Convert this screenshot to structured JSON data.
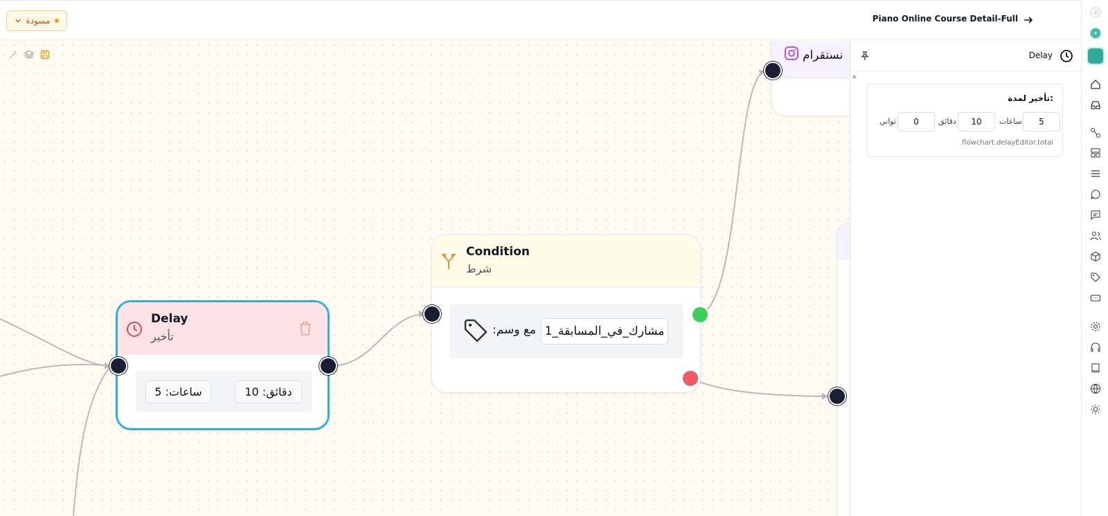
{
  "topbar": {
    "status_label": "مسودة",
    "page_title": "Piano Online Course Detail-Full"
  },
  "canvas": {
    "delay_node": {
      "title": "Delay",
      "subtitle": "تأخير",
      "minutes_chip": "دقائق: 10",
      "hours_chip": "ساعات: 5"
    },
    "condition_node": {
      "title": "Condition",
      "subtitle": "شرط",
      "with_tag_label": ":مع وسم",
      "tag_value": "مشارك_في_المسابقة_1"
    },
    "instagram_node": {
      "title_fragment": "نستقرام"
    }
  },
  "panel": {
    "title": "Delay",
    "card_title": "تأخير لمدة:",
    "hours_value": "5",
    "hours_unit": "ساعات",
    "minutes_value": "10",
    "minutes_unit": "دقائق",
    "seconds_value": "0",
    "seconds_unit": "ثواني",
    "total_note": "flowchart.delayEditor.total"
  },
  "colors": {
    "accent_teal": "#2bb3d6",
    "delay_header": "#fde3e6",
    "condition_header": "#fffbe6",
    "true_handle": "#3ccf57",
    "false_handle": "#f25a63",
    "draft_orange": "#f59e0b"
  },
  "rail_icons": [
    "collapse-icon",
    "avatar-dot-icon",
    "app-logo-icon",
    "home-icon",
    "inbox-icon",
    "flow-icon",
    "layout-icon",
    "list-icon",
    "chat-icon",
    "message-square-icon",
    "users-icon",
    "box-icon",
    "tag-icon",
    "card-icon",
    "settings-icon",
    "headphones-icon",
    "book-icon",
    "globe-icon",
    "sun-icon"
  ]
}
